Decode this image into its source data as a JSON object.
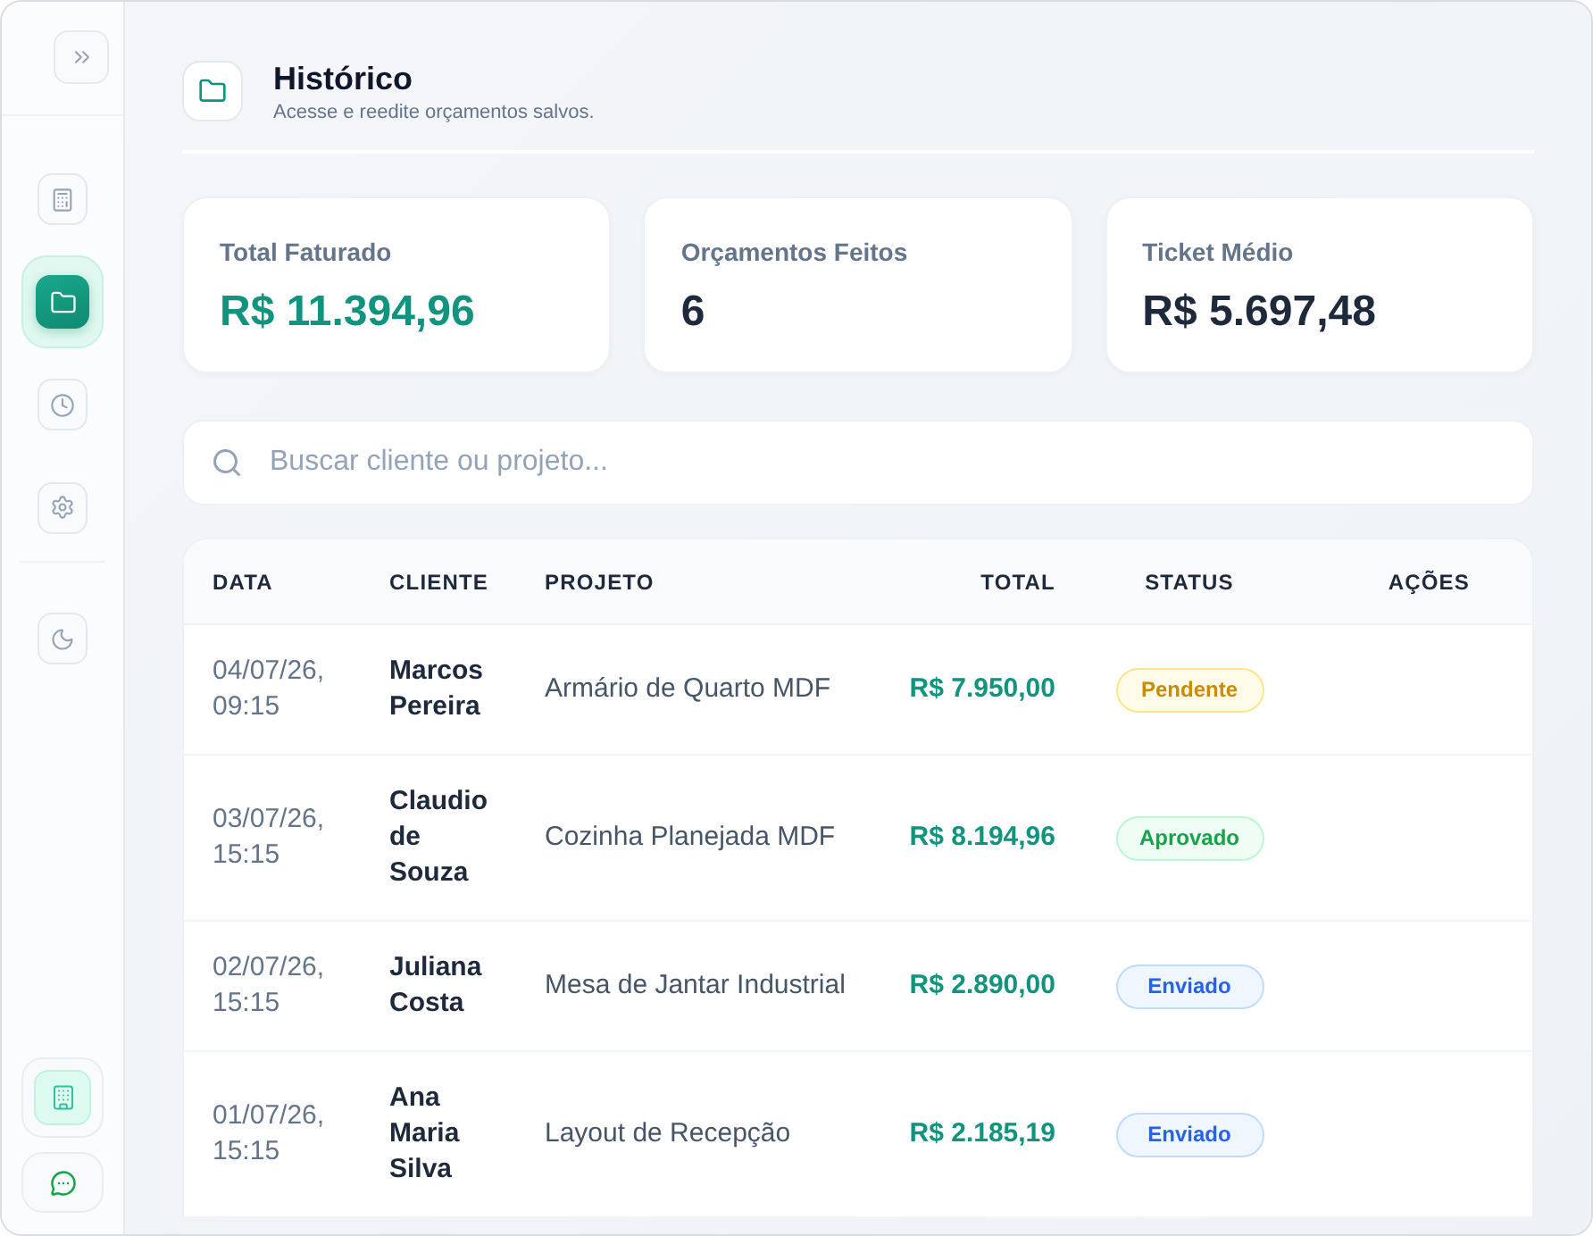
{
  "sidebar": {
    "nav": [
      {
        "selected": false
      },
      {
        "selected": true
      },
      {
        "selected": false
      },
      {
        "selected": false
      }
    ]
  },
  "header": {
    "title": "Histórico",
    "subtitle": "Acesse e reedite orçamentos salvos."
  },
  "stats": [
    {
      "label": "Total Faturado",
      "value": "R$ 11.394,96",
      "color": "#11947e"
    },
    {
      "label": "Orçamentos Feitos",
      "value": "6",
      "color": "#1e293b"
    },
    {
      "label": "Ticket Médio",
      "value": "R$ 5.697,48",
      "color": "#1e293b"
    }
  ],
  "search": {
    "placeholder": "Buscar cliente ou projeto..."
  },
  "table": {
    "columns": [
      "DATA",
      "CLIENTE",
      "PROJETO",
      "TOTAL",
      "STATUS",
      "AÇÕES"
    ],
    "rows": [
      {
        "date": "04/07/26, 09:15",
        "client": "Marcos Pereira",
        "project": "Armário de Quarto MDF",
        "total": "R$ 7.950,00",
        "status": {
          "label": "Pendente",
          "kind": "pending"
        }
      },
      {
        "date": "03/07/26, 15:15",
        "client": "Claudio de Souza",
        "project": "Cozinha Planejada MDF",
        "total": "R$ 8.194,96",
        "status": {
          "label": "Aprovado",
          "kind": "approved"
        }
      },
      {
        "date": "02/07/26, 15:15",
        "client": "Juliana Costa",
        "project": "Mesa de Jantar Industrial",
        "total": "R$ 2.890,00",
        "status": {
          "label": "Enviado",
          "kind": "sent"
        }
      },
      {
        "date": "01/07/26, 15:15",
        "client": "Ana Maria Silva",
        "project": "Layout de Recepção",
        "total": "R$ 2.185,19",
        "status": {
          "label": "Enviado",
          "kind": "sent"
        }
      }
    ]
  }
}
